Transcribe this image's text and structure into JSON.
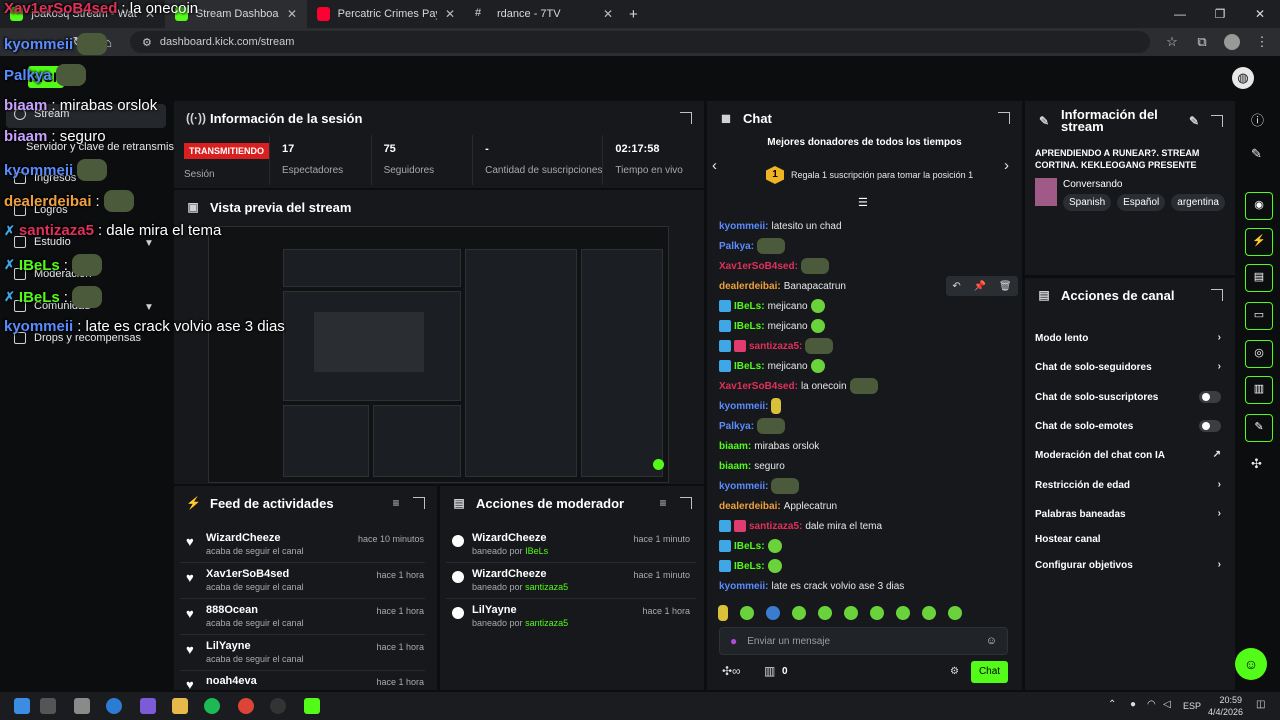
{
  "browser": {
    "tabs": [
      {
        "label": "joakosq Stream - Watch Live o"
      },
      {
        "label": "Stream Dashboard"
      },
      {
        "label": "Percatric Crimes Pay (Official M"
      },
      {
        "label": "rdance - 7TV"
      }
    ],
    "url": "dashboard.kick.com/stream"
  },
  "kick": {
    "logo": "KICK"
  },
  "sidebar": {
    "items": [
      {
        "label": "Stream"
      },
      {
        "label": "Servidor y clave de retransmisión"
      },
      {
        "label": "Ingresos"
      },
      {
        "label": "Logros"
      },
      {
        "label": "Estudio"
      },
      {
        "label": "Moderación"
      },
      {
        "label": "Comunidad"
      },
      {
        "label": "Drops y recompensas"
      }
    ]
  },
  "session": {
    "title": "Información de la sesión",
    "live_badge": "TRANSMITIENDO",
    "session_label": "Sesión",
    "stats": [
      {
        "value": "17",
        "label": "Espectadores"
      },
      {
        "value": "75",
        "label": "Seguidores"
      },
      {
        "value": "-",
        "label": "Cantidad de suscripciones"
      },
      {
        "value": "02:17:58",
        "label": "Tiempo en vivo"
      }
    ]
  },
  "preview": {
    "title": "Vista previa del stream"
  },
  "feed": {
    "title": "Feed de actividades",
    "items": [
      {
        "name": "WizardCheeze",
        "action": "acaba de seguir el canal",
        "time": "hace 10 minutos"
      },
      {
        "name": "Xav1erSoB4sed",
        "action": "acaba de seguir el canal",
        "time": "hace 1 hora"
      },
      {
        "name": "888Ocean",
        "action": "acaba de seguir el canal",
        "time": "hace 1 hora"
      },
      {
        "name": "LilYayne",
        "action": "acaba de seguir el canal",
        "time": "hace 1 hora"
      },
      {
        "name": "noah4eva",
        "action": "",
        "time": "hace 1 hora"
      }
    ]
  },
  "modactions": {
    "title": "Acciones de moderador",
    "items": [
      {
        "name": "WizardCheeze",
        "prefix": "baneado por",
        "by": "IBeLs",
        "time": "hace 1 minuto"
      },
      {
        "name": "WizardCheeze",
        "prefix": "baneado por",
        "by": "santizaza5",
        "time": "hace 1 minuto"
      },
      {
        "name": "LilYayne",
        "prefix": "baneado por",
        "by": "santizaza5",
        "time": "hace 1 hora"
      }
    ]
  },
  "chat": {
    "title": "Chat",
    "top_donors": "Mejores donadores de todos los tiempos",
    "rank": "1",
    "rank_text": "Regala 1 suscripción para tomar la posición 1",
    "messages": [
      {
        "user": "kyommeii",
        "text": "latesito un chad",
        "color": "#5b8cff"
      },
      {
        "user": "Palkya",
        "text": "",
        "color": "#5b8cff"
      },
      {
        "user": "Xav1erSoB4sed",
        "text": "",
        "color": "#e0315b"
      },
      {
        "user": "dealerdeibai",
        "text": "Banapacatrun",
        "color": "#f0a03c"
      },
      {
        "user": "IBeLs",
        "text": "mejicano",
        "color": "#53fc18"
      },
      {
        "user": "IBeLs",
        "text": "mejicano",
        "color": "#53fc18"
      },
      {
        "user": "santizaza5",
        "text": "",
        "color": "#e0315b"
      },
      {
        "user": "IBeLs",
        "text": "mejicano",
        "color": "#53fc18"
      },
      {
        "user": "Xav1erSoB4sed",
        "text": "la onecoin",
        "color": "#e0315b"
      },
      {
        "user": "kyommeii",
        "text": "",
        "color": "#5b8cff"
      },
      {
        "user": "Palkya",
        "text": "",
        "color": "#5b8cff"
      },
      {
        "user": "biaam",
        "text": "mirabas orslok",
        "color": "#53fc18"
      },
      {
        "user": "biaam",
        "text": "seguro",
        "color": "#53fc18"
      },
      {
        "user": "kyommeii",
        "text": "",
        "color": "#5b8cff"
      },
      {
        "user": "dealerdeibai",
        "text": "Applecatrun",
        "color": "#f0a03c"
      },
      {
        "user": "santizaza5",
        "text": "dale mira el tema",
        "color": "#e0315b"
      },
      {
        "user": "IBeLs",
        "text": "",
        "color": "#53fc18"
      },
      {
        "user": "IBeLs",
        "text": "",
        "color": "#53fc18"
      },
      {
        "user": "kyommeii",
        "text": "late es crack volvio ase 3 dias",
        "color": "#5b8cff"
      }
    ],
    "input_placeholder": "Enviar un mensaje",
    "points": "0",
    "send_label": "Chat"
  },
  "stream_info": {
    "title": "Información del stream",
    "stream_title": "APRENDIENDO A RUNEAR?. STREAM CORTINA. KEKLEOGANG PRESENTE",
    "category": "Conversando",
    "tags": [
      "Spanish",
      "Español",
      "argentina"
    ]
  },
  "channel_actions": {
    "title": "Acciones de canal",
    "items": [
      {
        "label": "Modo lento",
        "kind": "chevron"
      },
      {
        "label": "Chat de solo-seguidores",
        "kind": "chevron"
      },
      {
        "label": "Chat de solo-suscriptores",
        "kind": "toggle"
      },
      {
        "label": "Chat de solo-emotes",
        "kind": "toggle"
      },
      {
        "label": "Moderación del chat con IA",
        "kind": "external"
      },
      {
        "label": "Restricción de edad",
        "kind": "chevron"
      },
      {
        "label": "Palabras baneadas",
        "kind": "chevron"
      },
      {
        "label": "Hostear canal",
        "kind": "none"
      },
      {
        "label": "Configurar objetivos",
        "kind": "chevron"
      }
    ]
  },
  "overlay_chat": [
    {
      "user": "Xav1erSoB4sed",
      "text": ": la onecoin",
      "color": "#e0315b"
    },
    {
      "user": "kyommeii",
      "text": "",
      "color": "#5b8cff"
    },
    {
      "user": "Palkya",
      "text": "",
      "color": "#5b8cff"
    },
    {
      "user": "biaam",
      "text": ": mirabas orslok",
      "color": "#c8a0ff"
    },
    {
      "user": "biaam",
      "text": ": seguro",
      "color": "#c8a0ff"
    },
    {
      "user": "kyommeii",
      "text": "",
      "color": "#5b8cff"
    },
    {
      "user": "dealerdeibai",
      "text": ":",
      "color": "#f0a03c"
    },
    {
      "user": "santizaza5",
      "text": ": dale mira el tema",
      "color": "#e0315b"
    },
    {
      "user": "IBeLs",
      "text": ":",
      "color": "#53fc18"
    },
    {
      "user": "IBeLs",
      "text": ":",
      "color": "#53fc18"
    },
    {
      "user": "kyommeii",
      "text": ": late es crack volvio ase 3 dias",
      "color": "#5b8cff"
    }
  ],
  "taskbar": {
    "lang": "ESP",
    "time": "20:59",
    "date": "4/4/2026"
  },
  "colors": {
    "accent": "#53fc18",
    "live": "#d92020",
    "panel": "#16181b",
    "background": "#0b0d0f"
  }
}
